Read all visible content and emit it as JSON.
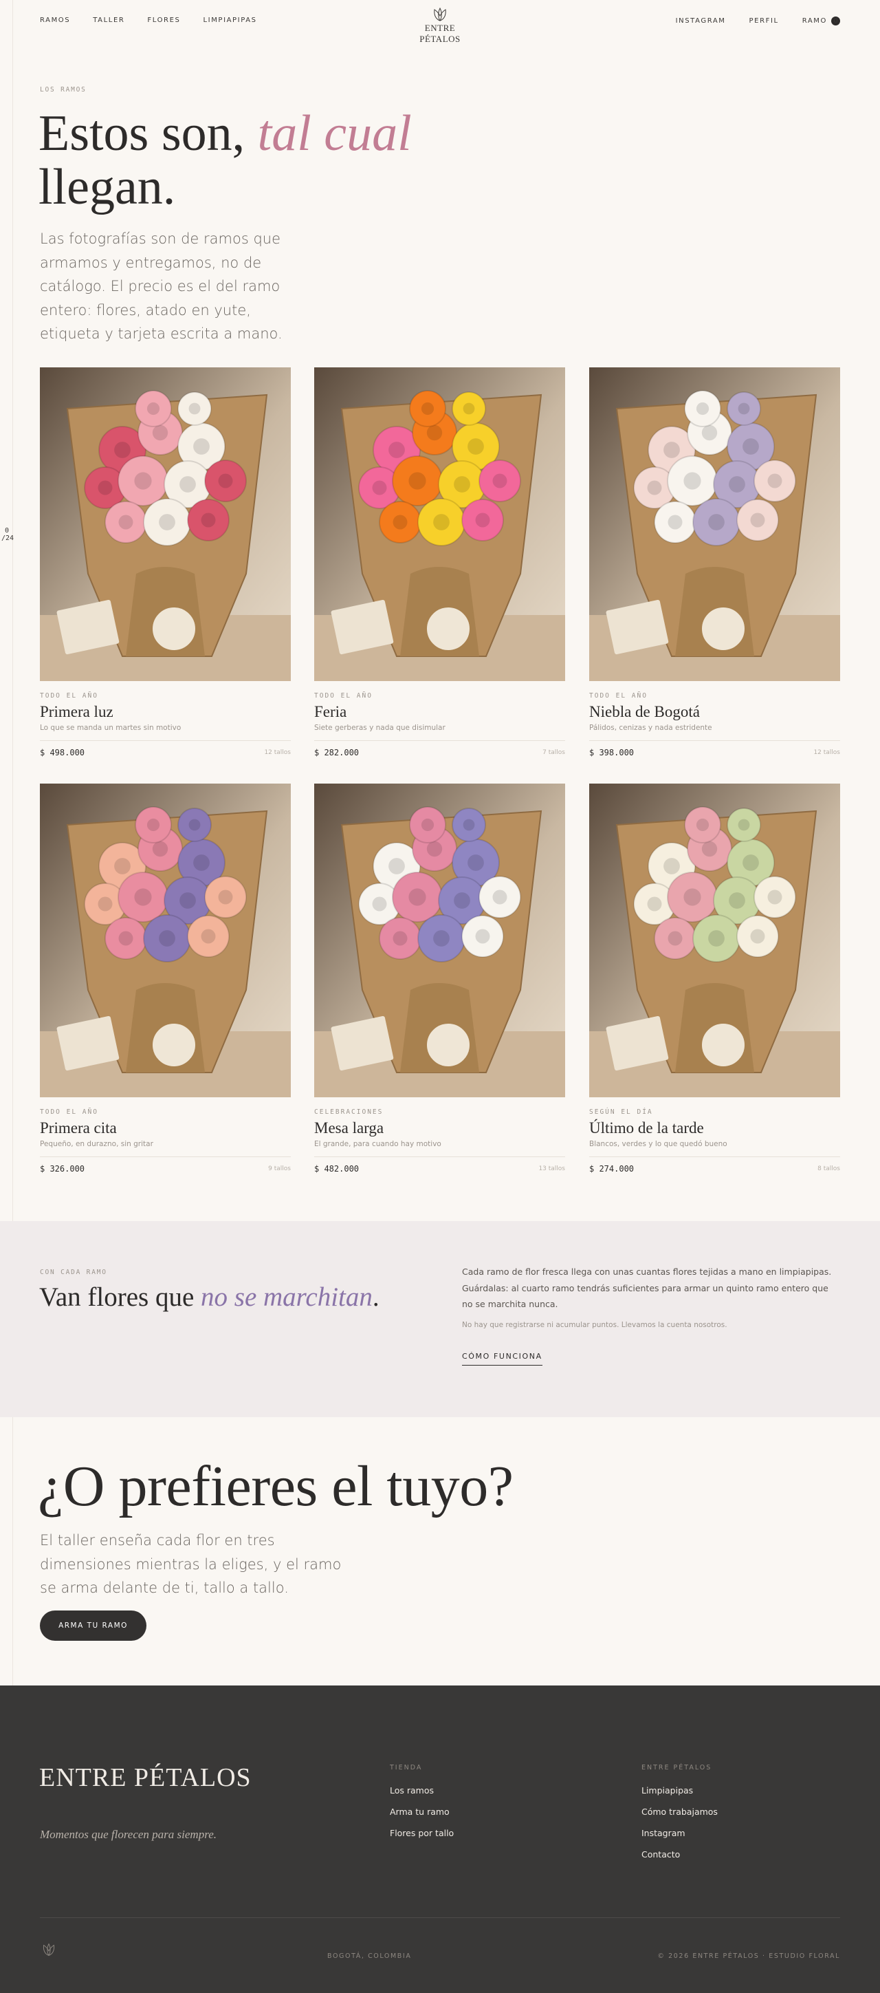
{
  "header": {
    "nav_left": [
      "RAMOS",
      "TALLER",
      "FLORES",
      "LIMPIAPIPAS"
    ],
    "logo_text": "ENTRE PÉTALOS",
    "nav_right": [
      "INSTAGRAM",
      "PERFIL",
      "RAMO"
    ],
    "cart_count": "0"
  },
  "side_counter": {
    "current": "0",
    "total": "/24"
  },
  "hero": {
    "eyebrow": "LOS RAMOS",
    "title_a": "Estos son, ",
    "title_em": "tal cual",
    "title_b": " llegan.",
    "description": "Las fotografías son de ramos que armamos y entregamos, no de catálogo. El precio es el del ramo entero: flores, atado en yute, etiqueta y tarjeta escrita a mano."
  },
  "products": [
    {
      "eyebrow": "TODO EL AÑO",
      "name": "Primera luz",
      "subtitle": "Lo que se manda un martes sin motivo",
      "price": "$ 498.000",
      "stems": "12 tallos",
      "palette": [
        "#d9546b",
        "#f1a7b1",
        "#f6f0e6"
      ]
    },
    {
      "eyebrow": "TODO EL AÑO",
      "name": "Feria",
      "subtitle": "Siete gerberas y nada que disimular",
      "price": "$ 282.000",
      "stems": "7 tallos",
      "palette": [
        "#f2689a",
        "#f47b1c",
        "#f7d02a"
      ]
    },
    {
      "eyebrow": "TODO EL AÑO",
      "name": "Niebla de Bogotá",
      "subtitle": "Pálidos, cenizas y nada estridente",
      "price": "$ 398.000",
      "stems": "12 tallos",
      "palette": [
        "#f3d9d2",
        "#f8f4ee",
        "#b6a8c9"
      ]
    },
    {
      "eyebrow": "TODO EL AÑO",
      "name": "Primera cita",
      "subtitle": "Pequeño, en durazno, sin gritar",
      "price": "$ 326.000",
      "stems": "9 tallos",
      "palette": [
        "#f3b49a",
        "#e98da0",
        "#8a79b5"
      ]
    },
    {
      "eyebrow": "CELEBRACIONES",
      "name": "Mesa larga",
      "subtitle": "El grande, para cuando hay motivo",
      "price": "$ 482.000",
      "stems": "13 tallos",
      "palette": [
        "#f7f4ee",
        "#e58aa3",
        "#8f86c2"
      ]
    },
    {
      "eyebrow": "SEGÚN EL DÍA",
      "name": "Último de la tarde",
      "subtitle": "Blancos, verdes y lo que quedó bueno",
      "price": "$ 274.000",
      "stems": "8 tallos",
      "palette": [
        "#f6efdf",
        "#e9a5ad",
        "#c9d6a2"
      ]
    }
  ],
  "band": {
    "eyebrow": "CON CADA RAMO",
    "title_a": "Van flores que ",
    "title_em": "no se marchitan",
    "title_b": ".",
    "text": "Cada ramo de flor fresca llega con unas cuantas flores tejidas a mano en limpiapipas. Guárdalas: al cuarto ramo tendrás suficientes para armar un quinto ramo entero que no se marchita nunca.",
    "note": "No hay que registrarse ni acumular puntos. Llevamos la cuenta nosotros.",
    "link": "CÓMO FUNCIONA"
  },
  "custom": {
    "title": "¿O prefieres el tuyo?",
    "description": "El taller enseña cada flor en tres dimensiones mientras la eliges, y el ramo se arma delante de ti, tallo a tallo.",
    "button": "ARMA TU RAMO"
  },
  "footer": {
    "brand": "ENTRE PÉTALOS",
    "tagline": "Momentos que florecen para siempre.",
    "col1_title": "TIENDA",
    "col1_links": [
      "Los ramos",
      "Arma tu ramo",
      "Flores por tallo"
    ],
    "col2_title": "ENTRE PÉTALOS",
    "col2_links": [
      "Limpiapipas",
      "Cómo trabajamos",
      "Instagram",
      "Contacto"
    ],
    "location": "BOGOTÁ, COLOMBIA",
    "copyright": "© 2026 ENTRE PÉTALOS · ESTUDIO FLORAL"
  }
}
